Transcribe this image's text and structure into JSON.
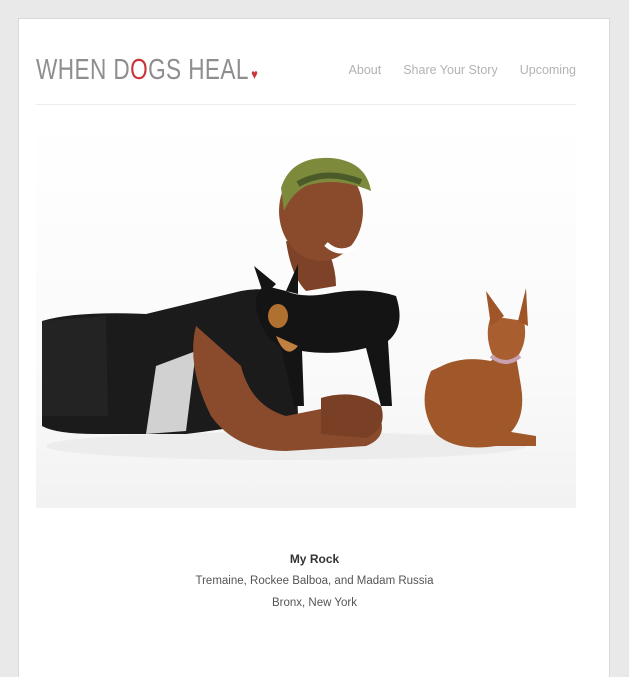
{
  "logo": {
    "text_pre": "WHEN D",
    "text_accent": "O",
    "text_post": "GS HEAL",
    "accent_color": "#c9343a"
  },
  "nav": {
    "items": [
      {
        "label": "About"
      },
      {
        "label": "Share Your Story"
      },
      {
        "label": "Upcoming"
      }
    ]
  },
  "photo": {
    "description_icon": "portrait-photo"
  },
  "caption": {
    "title": "My Rock",
    "names": "Tremaine, Rockee Balboa, and Madam Russia",
    "location": "Bronx, New York"
  }
}
